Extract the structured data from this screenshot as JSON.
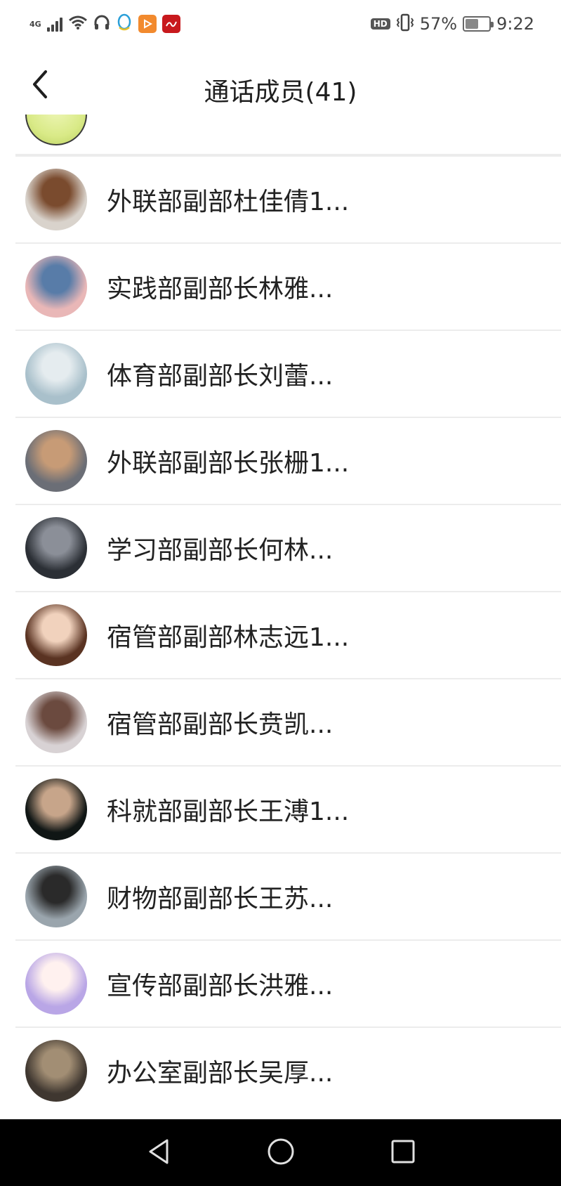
{
  "status_bar": {
    "network_type": "4G",
    "battery_percent_text": "57%",
    "battery_level": 0.57,
    "hd_label": "HD",
    "time": "9:22",
    "icons": [
      "signal-icon",
      "wifi-icon",
      "headphones-icon",
      "qq-icon",
      "video-app-icon",
      "news-app-icon",
      "vibrate-icon",
      "battery-icon"
    ],
    "colors": {
      "video_app": "#f28a2e",
      "news_app": "#c8191d",
      "qq": "#2a9fd8"
    }
  },
  "header": {
    "title": "通话成员(41)",
    "back_icon": "chevron-left-icon"
  },
  "members": [
    {
      "name": "外联部副部杜佳倩1...",
      "avatar_colors": [
        "#d9d3cc",
        "#7a4b2e"
      ]
    },
    {
      "name": "实践部副部长林雅...",
      "avatar_colors": [
        "#e9b7b7",
        "#587ca8"
      ]
    },
    {
      "name": "体育部副部长刘蕾...",
      "avatar_colors": [
        "#a9c0cb",
        "#e5ecef"
      ]
    },
    {
      "name": "外联部副部长张栅1...",
      "avatar_colors": [
        "#6b6e76",
        "#c79b76"
      ]
    },
    {
      "name": "学习部副部长何林...",
      "avatar_colors": [
        "#2b2f35",
        "#8b8f98"
      ]
    },
    {
      "name": "宿管部副部林志远1...",
      "avatar_colors": [
        "#5a3322",
        "#f1d2bd"
      ]
    },
    {
      "name": "宿管部副部长贲凯...",
      "avatar_colors": [
        "#d8d2d4",
        "#6b4a3f"
      ]
    },
    {
      "name": "科就部副部长王溥1...",
      "avatar_colors": [
        "#101615",
        "#c7a58a"
      ]
    },
    {
      "name": "财物部副部长王苏...",
      "avatar_colors": [
        "#9aa5ad",
        "#2a2a2a"
      ]
    },
    {
      "name": "宣传部副部长洪雅...",
      "avatar_colors": [
        "#b9a6e6",
        "#fff1ef"
      ]
    },
    {
      "name": "办公室副部长吴厚...",
      "avatar_colors": [
        "#3f3730",
        "#a28e74"
      ]
    }
  ],
  "nav": {
    "icons": [
      "back-triangle-icon",
      "home-circle-icon",
      "recents-square-icon"
    ]
  }
}
